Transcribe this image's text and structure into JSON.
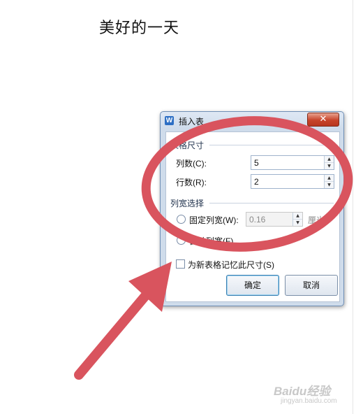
{
  "document": {
    "title": "美好的一天"
  },
  "dialog": {
    "title": "插入表",
    "close_glyph": "✕",
    "table_size": {
      "group_label": "表格尺寸",
      "columns_label": "列数(C):",
      "columns_value": "5",
      "rows_label": "行数(R):",
      "rows_value": "2"
    },
    "column_width": {
      "group_label": "列宽选择",
      "fixed_label": "固定列宽(W):",
      "fixed_value": "0.16",
      "unit": "厘米",
      "auto_label": "自动列宽(F)"
    },
    "remember_label": "为新表格记忆此尺寸(S)",
    "ok_label": "确定",
    "cancel_label": "取消"
  },
  "annotation": {
    "color": "#d9545e"
  },
  "watermark": {
    "text": "Baidu经验",
    "sub": "jingyan.baidu.com"
  }
}
